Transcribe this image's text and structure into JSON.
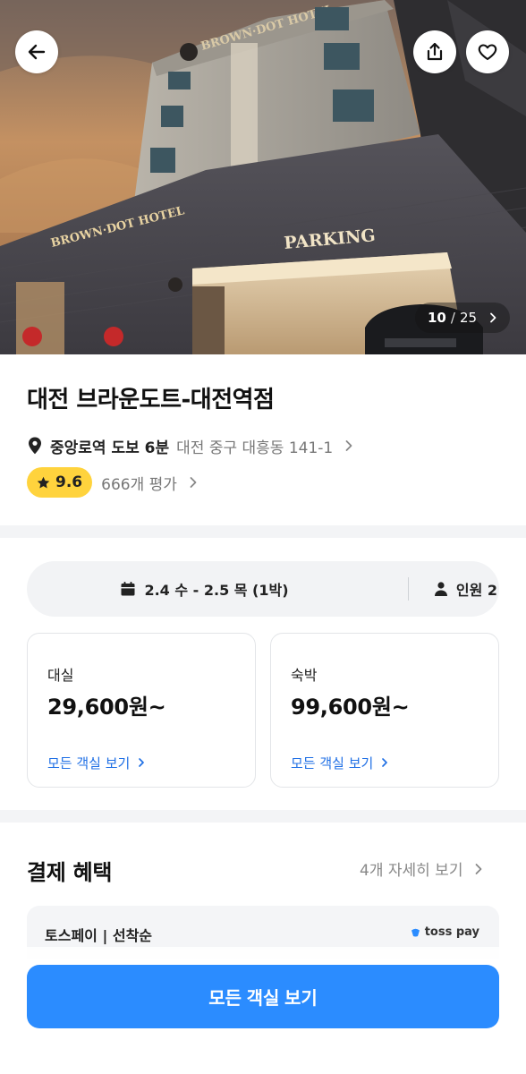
{
  "gallery": {
    "current": "10",
    "separator": "/",
    "total": "25"
  },
  "hotel": {
    "name": "대전 브라운도트-대전역점",
    "landmark": "중앙로역 도보 6분",
    "address": "대전 중구 대흥동 141-1",
    "rating": "9.6",
    "reviews": "666개 평가"
  },
  "booking": {
    "dates": "2.4 수 - 2.5 목 (1박)",
    "guests": "인원 2"
  },
  "rooms": [
    {
      "type": "대실",
      "price": "29,600원~",
      "link": "모든 객실 보기"
    },
    {
      "type": "숙박",
      "price": "99,600원~",
      "link": "모든 객실 보기"
    }
  ],
  "benefits": {
    "title": "결제 혜택",
    "more": "4개 자세히 보기",
    "item": "토스페이 | 선착순",
    "logo_text": "toss pay"
  },
  "cta": {
    "label": "모든 객실 보기"
  },
  "colors": {
    "accent": "#2b8cff",
    "link": "#1f6fe5",
    "rating_badge": "#ffd33d"
  },
  "icons": [
    "back-arrow-icon",
    "share-icon",
    "heart-icon",
    "chevron-right-icon",
    "location-pin-icon",
    "star-icon",
    "calendar-icon",
    "person-icon",
    "toss-icon"
  ]
}
